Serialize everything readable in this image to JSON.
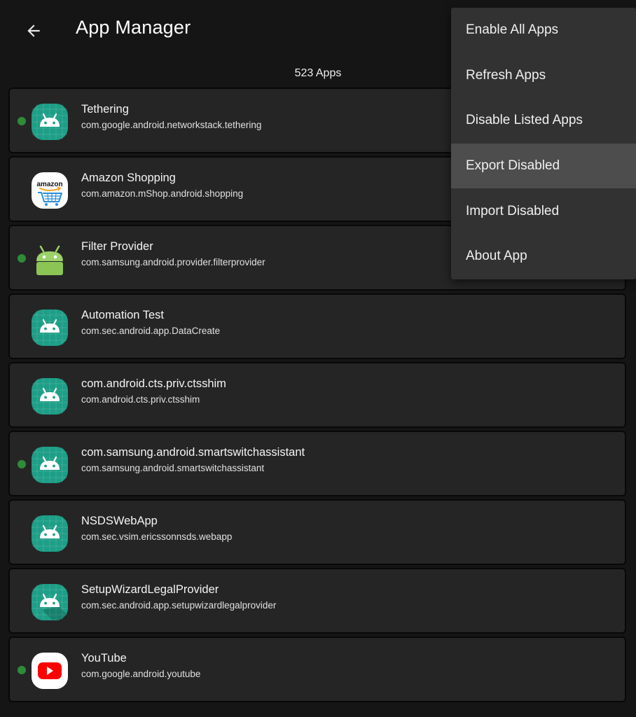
{
  "header": {
    "title": "App Manager",
    "back_icon": "arrow-left-icon"
  },
  "app_count": "523 Apps",
  "colors": {
    "background": "#151515",
    "row_background": "#252525",
    "enabled_dot": "#2e8b3a",
    "android_icon_teal": "#1e9e87",
    "menu_background": "#323232",
    "menu_highlight": "#4d4d4d"
  },
  "apps": [
    {
      "name": "Tethering",
      "package": "com.google.android.networkstack.tethering",
      "enabled_dot": true,
      "icon": "android-teal"
    },
    {
      "name": "Amazon Shopping",
      "package": "com.amazon.mShop.android.shopping",
      "enabled_dot": false,
      "icon": "amazon"
    },
    {
      "name": "Filter Provider",
      "package": "com.samsung.android.provider.filterprovider",
      "enabled_dot": true,
      "icon": "android-green"
    },
    {
      "name": "Automation Test",
      "package": "com.sec.android.app.DataCreate",
      "enabled_dot": false,
      "icon": "android-teal"
    },
    {
      "name": "com.android.cts.priv.ctsshim",
      "package": "com.android.cts.priv.ctsshim",
      "enabled_dot": false,
      "icon": "android-teal"
    },
    {
      "name": "com.samsung.android.smartswitchassistant",
      "package": "com.samsung.android.smartswitchassistant",
      "enabled_dot": true,
      "icon": "android-teal"
    },
    {
      "name": "NSDSWebApp",
      "package": "com.sec.vsim.ericssonnsds.webapp",
      "enabled_dot": false,
      "icon": "android-teal"
    },
    {
      "name": "SetupWizardLegalProvider",
      "package": "com.sec.android.app.setupwizardlegalprovider",
      "enabled_dot": false,
      "icon": "android-teal-shadow"
    },
    {
      "name": "YouTube",
      "package": "com.google.android.youtube",
      "enabled_dot": true,
      "icon": "youtube"
    }
  ],
  "menu": {
    "items": [
      {
        "label": "Enable All Apps",
        "highlighted": false
      },
      {
        "label": "Refresh Apps",
        "highlighted": false
      },
      {
        "label": "Disable Listed Apps",
        "highlighted": false
      },
      {
        "label": "Export Disabled",
        "highlighted": true
      },
      {
        "label": "Import Disabled",
        "highlighted": false
      },
      {
        "label": "About App",
        "highlighted": false
      }
    ]
  },
  "amazon_logo_text": "amazon"
}
